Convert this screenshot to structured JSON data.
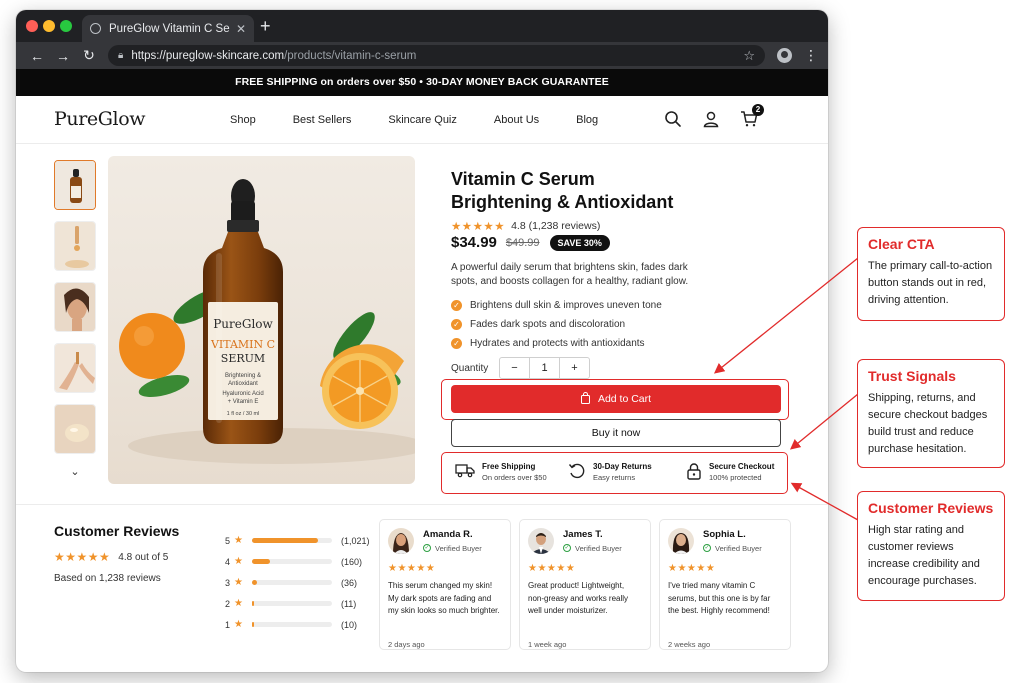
{
  "browser": {
    "tab_title": "PureGlow Vitamin C Serum –",
    "url_host": "https://pureglow-skincare.com",
    "url_path": "/products/vitamin-c-serum",
    "traffic_light_colors": [
      "#ff5f57",
      "#febc2e",
      "#28c840"
    ]
  },
  "promo": {
    "text": "FREE SHIPPING on orders over $50  •  30-DAY MONEY BACK GUARANTEE"
  },
  "site": {
    "logo": "PureGlow",
    "nav": [
      "Shop",
      "Best Sellers",
      "Skincare Quiz",
      "About Us",
      "Blog"
    ],
    "cart_count": "2"
  },
  "product": {
    "title_line1": "Vitamin C Serum",
    "title_line2": "Brightening & Antioxidant",
    "rating_stars": 4.8,
    "rating_text": "4.8 (1,238 reviews)",
    "price": "$34.99",
    "old_price": "$49.99",
    "save_badge": "SAVE 30%",
    "description": "A powerful daily serum that brightens skin, fades dark spots, and boosts collagen for a healthy, radiant glow.",
    "benefits": [
      "Brightens dull skin & improves uneven tone",
      "Fades dark spots and discoloration",
      "Hydrates and protects with antioxidants"
    ],
    "quantity_label": "Quantity",
    "quantity_value": "1",
    "qty_minus": "−",
    "qty_plus": "+",
    "add_to_cart": "Add to Cart",
    "buy_now": "Buy it now",
    "bottle_label": {
      "brand": "PureGlow",
      "line1": "VITAMIN C",
      "line2": "SERUM",
      "sub1": "Brightening &",
      "sub2": "Antioxidant",
      "sub3": "Hyaluronic Acid",
      "sub4": "+ Vitamin E",
      "volume": "1 fl oz / 30 ml"
    },
    "accent_color": "#e12b2b",
    "star_color": "#f0932b"
  },
  "trust": [
    {
      "icon": "truck-icon",
      "title": "Free Shipping",
      "sub": "On orders over $50"
    },
    {
      "icon": "return-icon",
      "title": "30-Day Returns",
      "sub": "Easy returns"
    },
    {
      "icon": "lock-icon",
      "title": "Secure Checkout",
      "sub": "100% protected"
    }
  ],
  "reviews": {
    "heading": "Customer Reviews",
    "avg_text": "4.8 out of 5",
    "based_on": "Based on 1,238 reviews",
    "breakdown": [
      {
        "stars": "5",
        "count": "(1,021)",
        "fraction": 0.82
      },
      {
        "stars": "4",
        "count": "(160)",
        "fraction": 0.23
      },
      {
        "stars": "3",
        "count": "(36)",
        "fraction": 0.06
      },
      {
        "stars": "2",
        "count": "(11)",
        "fraction": 0.02
      },
      {
        "stars": "1",
        "count": "(10)",
        "fraction": 0.02
      }
    ],
    "cards": [
      {
        "name": "Amanda R.",
        "verified": "Verified Buyer",
        "text": "This serum changed my skin! My dark spots are fading and my skin looks so much brighter.",
        "date": "2 days ago"
      },
      {
        "name": "James T.",
        "verified": "Verified Buyer",
        "text": "Great product! Lightweight, non-greasy and works really well under moisturizer.",
        "date": "1 week ago"
      },
      {
        "name": "Sophia L.",
        "verified": "Verified Buyer",
        "text": "I've tried many vitamin C serums, but this one is by far the best. Highly recommend!",
        "date": "2 weeks ago"
      }
    ]
  },
  "callouts": [
    {
      "title": "Clear CTA",
      "body": "The primary call-to-action button stands out in red, driving attention."
    },
    {
      "title": "Trust Signals",
      "body": "Shipping, returns, and secure checkout badges build trust and reduce purchase hesitation."
    },
    {
      "title": "Customer Reviews",
      "body": "High star rating and customer reviews increase credibility and encourage purchases."
    }
  ]
}
